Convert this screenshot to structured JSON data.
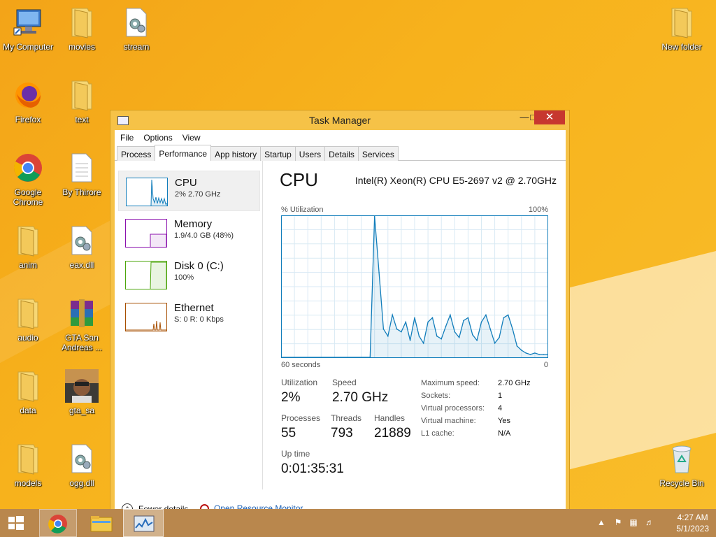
{
  "desktop": {
    "icons": [
      {
        "label": "My Computer",
        "icon": "computer-icon"
      },
      {
        "label": "movies",
        "icon": "folder-icon"
      },
      {
        "label": "stream",
        "icon": "settings-file-icon"
      },
      {
        "label": "New folder",
        "icon": "folder-icon"
      },
      {
        "label": "Firefox",
        "icon": "firefox-icon"
      },
      {
        "label": "text",
        "icon": "folder-icon"
      },
      {
        "label": "Google Chrome",
        "icon": "chrome-icon"
      },
      {
        "label": "By Thirore",
        "icon": "document-icon"
      },
      {
        "label": "anim",
        "icon": "folder-icon"
      },
      {
        "label": "eax.dll",
        "icon": "settings-file-icon"
      },
      {
        "label": "audio",
        "icon": "folder-icon"
      },
      {
        "label": "GTA San Andreas ...",
        "icon": "winrar-icon"
      },
      {
        "label": "data",
        "icon": "folder-icon"
      },
      {
        "label": "gta_sa",
        "icon": "gta-icon"
      },
      {
        "label": "models",
        "icon": "folder-icon"
      },
      {
        "label": "ogg.dll",
        "icon": "settings-file-icon"
      },
      {
        "label": "Recycle Bin",
        "icon": "recycle-bin-icon"
      }
    ]
  },
  "window": {
    "title": "Task Manager",
    "menu": [
      "File",
      "Options",
      "View"
    ],
    "tabs": [
      "Process",
      "Performance",
      "App history",
      "Startup",
      "Users",
      "Details",
      "Services"
    ],
    "active_tab": "Performance",
    "resources": [
      {
        "name": "CPU",
        "detail": "2% 2.70 GHz",
        "color": "#117dbb"
      },
      {
        "name": "Memory",
        "detail": "1.9/4.0 GB (48%)",
        "color": "#8b12ae"
      },
      {
        "name": "Disk 0 (C:)",
        "detail": "100%",
        "color": "#4da60c"
      },
      {
        "name": "Ethernet",
        "detail": "S: 0 R: 0 Kbps",
        "color": "#a74f01"
      }
    ],
    "detail": {
      "title": "CPU",
      "model": "Intel(R) Xeon(R) CPU E5-2697 v2 @ 2.70GHz",
      "y_label": "% Utilization",
      "y_max_label": "100%",
      "x_left_label": "60 seconds",
      "x_right_label": "0",
      "utilization_label": "Utilization",
      "utilization": "2%",
      "speed_label": "Speed",
      "speed": "2.70 GHz",
      "processes_label": "Processes",
      "processes": "55",
      "threads_label": "Threads",
      "threads": "793",
      "handles_label": "Handles",
      "handles": "21889",
      "uptime_label": "Up time",
      "uptime": "0:01:35:31",
      "specs": [
        {
          "k": "Maximum speed:",
          "v": "2.70 GHz"
        },
        {
          "k": "Sockets:",
          "v": "1"
        },
        {
          "k": "Virtual processors:",
          "v": "4"
        },
        {
          "k": "Virtual machine:",
          "v": "Yes"
        },
        {
          "k": "L1 cache:",
          "v": "N/A"
        }
      ]
    },
    "footer": {
      "fewer": "Fewer details",
      "monitor": "Open Resource Monitor"
    }
  },
  "chart_data": {
    "type": "area",
    "x": [
      60,
      40,
      39,
      38,
      37,
      36,
      35,
      34,
      33,
      32,
      31,
      30,
      29,
      28,
      27,
      26,
      25,
      24,
      23,
      22,
      21,
      20,
      19,
      18,
      17,
      16,
      15,
      14,
      13,
      12,
      11,
      10,
      9,
      8,
      7,
      6,
      5,
      4,
      3,
      2,
      1,
      0
    ],
    "values": [
      0,
      0,
      100,
      60,
      20,
      15,
      30,
      20,
      18,
      25,
      12,
      28,
      15,
      10,
      25,
      28,
      15,
      13,
      22,
      30,
      18,
      14,
      26,
      28,
      16,
      12,
      25,
      30,
      20,
      10,
      14,
      28,
      30,
      20,
      8,
      5,
      3,
      2,
      3,
      2,
      2,
      2
    ],
    "ylim": [
      0,
      100
    ],
    "xlim": [
      60,
      0
    ],
    "color": "#117dbb",
    "grid": true
  },
  "taskbar": {
    "time": "4:27 AM",
    "date": "5/1/2023"
  }
}
